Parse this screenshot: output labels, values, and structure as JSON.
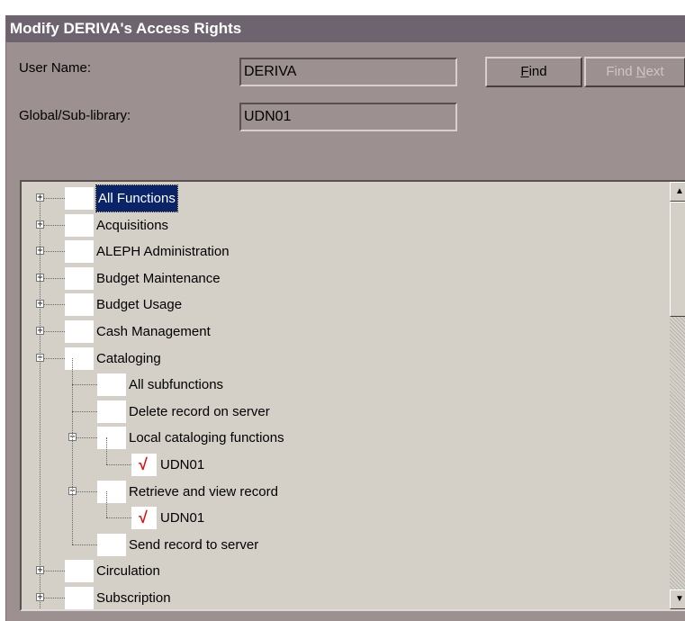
{
  "dialog": {
    "title": "Modify DERIVA's Access Rights",
    "user_name_label": "User Name:",
    "user_name_value": "DERIVA",
    "sublibrary_label": "Global/Sub-library:",
    "sublibrary_value": "UDN01",
    "find_button": "Find",
    "find_next_button": "Find Next"
  },
  "tree": {
    "items": [
      {
        "label": "All Functions",
        "expander": "+",
        "selected": true
      },
      {
        "label": "Acquisitions",
        "expander": "+"
      },
      {
        "label": "ALEPH Administration",
        "expander": "+"
      },
      {
        "label": "Budget Maintenance",
        "expander": "+"
      },
      {
        "label": "Budget Usage",
        "expander": "+"
      },
      {
        "label": "Cash Management",
        "expander": "+"
      },
      {
        "label": "Cataloging",
        "expander": "−"
      },
      {
        "label": "All subfunctions"
      },
      {
        "label": "Delete record on server"
      },
      {
        "label": "Local cataloging functions",
        "expander": "−"
      },
      {
        "label": "UDN01",
        "checked": true
      },
      {
        "label": "Retrieve and view record",
        "expander": "−"
      },
      {
        "label": "UDN01",
        "checked": true
      },
      {
        "label": "Send record to server"
      },
      {
        "label": "Circulation",
        "expander": "+"
      },
      {
        "label": "Subscription",
        "expander": "+"
      }
    ],
    "check_glyph": "√"
  },
  "scrollbar": {
    "up_glyph": "▲",
    "down_glyph": "▼"
  }
}
